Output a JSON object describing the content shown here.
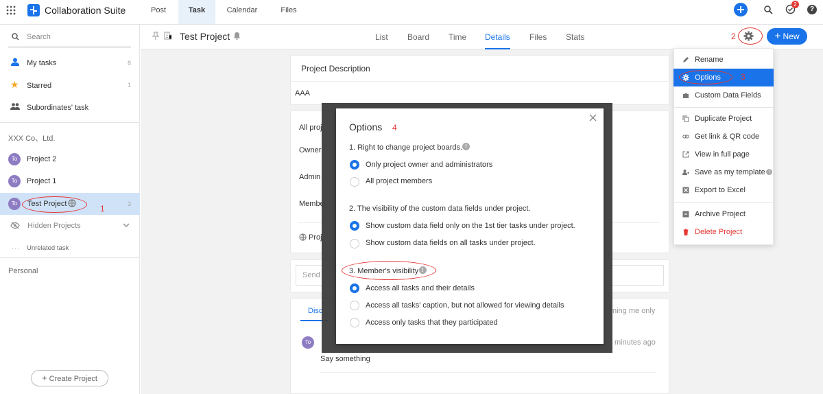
{
  "app": {
    "title": "Collaboration Suite"
  },
  "topnav": {
    "tabs": [
      {
        "label": "Post"
      },
      {
        "label": "Task"
      },
      {
        "label": "Calendar"
      },
      {
        "label": "Files"
      }
    ],
    "notification_count": "2"
  },
  "sidebar": {
    "search_placeholder": "Search",
    "items": [
      {
        "label": "My tasks",
        "count": "8"
      },
      {
        "label": "Starred",
        "count": "1"
      },
      {
        "label": "Subordinates' task",
        "count": ""
      }
    ],
    "company": "XXX Co、Ltd.",
    "projects": [
      {
        "avatar": "To",
        "label": "Project 2",
        "count": ""
      },
      {
        "avatar": "To",
        "label": "Project 1",
        "count": ""
      },
      {
        "avatar": "To",
        "label": "Test Project",
        "count": "3"
      }
    ],
    "hidden_projects": "Hidden Projects",
    "unrelated": "Unrelated task",
    "personal": "Personal",
    "create_project": "Create Project"
  },
  "project_header": {
    "title": "Test Project",
    "tabs": [
      {
        "label": "List"
      },
      {
        "label": "Board"
      },
      {
        "label": "Time"
      },
      {
        "label": "Details"
      },
      {
        "label": "Files"
      },
      {
        "label": "Stats"
      }
    ],
    "new_button": "New"
  },
  "details": {
    "description_title": "Project Description",
    "description_value": "AAA",
    "card2_partial": [
      "All proj",
      "Owner",
      "Admin",
      "Membe",
      "Proj"
    ],
    "send_placeholder": "Send",
    "discussion_tab": "Disc",
    "mentioning": "ning me only",
    "time_ago": "minutes ago",
    "comment_avatar": "To",
    "comment_text": "Say something"
  },
  "options_dialog": {
    "title": "Options",
    "sections": [
      {
        "heading": "1. Right to change project boards.",
        "options": [
          {
            "label": "Only project owner and administrators",
            "selected": true
          },
          {
            "label": "All project members",
            "selected": false
          }
        ]
      },
      {
        "heading": "2. The visibility of the custom data fields under project.",
        "options": [
          {
            "label": "Show custom data field only on the 1st tier tasks under project.",
            "selected": true
          },
          {
            "label": "Show custom data fields on all tasks under project.",
            "selected": false
          }
        ]
      },
      {
        "heading": "3. Member's visibility",
        "options": [
          {
            "label": "Access all tasks and their details",
            "selected": true
          },
          {
            "label": "Access all tasks' caption, but not allowed for viewing details",
            "selected": false
          },
          {
            "label": "Access only tasks that they participated",
            "selected": false
          }
        ]
      }
    ]
  },
  "dropdown_menu": {
    "items": [
      {
        "label": "Rename",
        "icon": "pencil-icon"
      },
      {
        "label": "Options",
        "icon": "gear-icon",
        "active": true
      },
      {
        "label": "Custom Data Fields",
        "icon": "puzzle-icon"
      },
      {
        "label": "Duplicate Project",
        "icon": "copy-icon"
      },
      {
        "label": "Get link & QR code",
        "icon": "link-icon"
      },
      {
        "label": "View in full page",
        "icon": "external-icon"
      },
      {
        "label": "Save as my template",
        "icon": "template-icon"
      },
      {
        "label": "Export to Excel",
        "icon": "excel-icon"
      },
      {
        "label": "Archive Project",
        "icon": "archive-icon"
      },
      {
        "label": "Delete Project",
        "icon": "trash-icon",
        "danger": true
      }
    ]
  },
  "annotations": [
    "1",
    "2",
    "3",
    "4"
  ],
  "colors": {
    "accent": "#1a73e8",
    "annotation": "#e53935",
    "danger": "#e53935",
    "avatar": "#8e7cc3"
  }
}
